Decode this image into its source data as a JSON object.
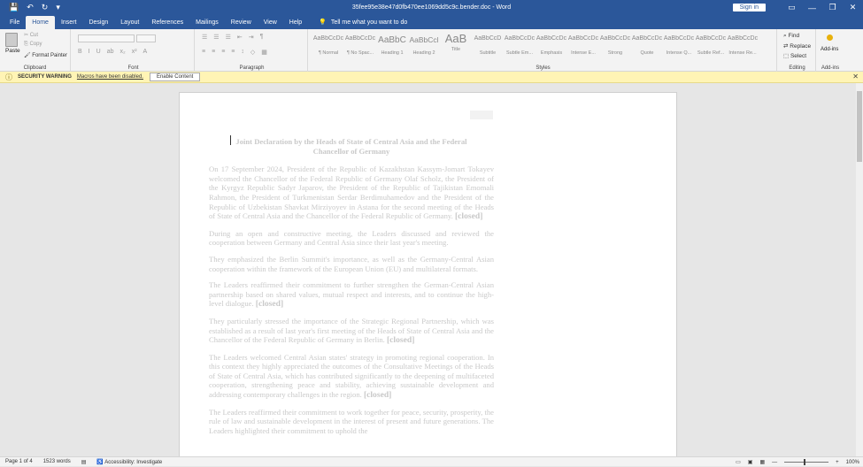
{
  "titlebar": {
    "quick_access": [
      "💾",
      "↶",
      "↻",
      "▾"
    ],
    "title": "35fee95e38e47d0fb470ee1069dd5c9c.bender.doc - Word",
    "sign_in": "Sign in",
    "window_buttons": [
      "▭",
      "—",
      "❐",
      "✕"
    ]
  },
  "tabs": [
    {
      "label": "File",
      "active": false
    },
    {
      "label": "Home",
      "active": true
    },
    {
      "label": "Insert",
      "active": false
    },
    {
      "label": "Design",
      "active": false
    },
    {
      "label": "Layout",
      "active": false
    },
    {
      "label": "References",
      "active": false
    },
    {
      "label": "Mailings",
      "active": false
    },
    {
      "label": "Review",
      "active": false
    },
    {
      "label": "View",
      "active": false
    },
    {
      "label": "Help",
      "active": false
    }
  ],
  "tell_me": {
    "icon": "lightbulb-icon",
    "glyph": "💡",
    "text": "Tell me what you want to do"
  },
  "ribbon": {
    "clipboard": {
      "label": "Clipboard",
      "paste": "Paste",
      "cut": "Cut",
      "copy": "Copy",
      "format_painter": "Format Painter"
    },
    "font": {
      "label": "Font"
    },
    "paragraph": {
      "label": "Paragraph"
    },
    "styles": {
      "label": "Styles",
      "items": [
        {
          "preview": "AaBbCcDc",
          "name": "¶ Normal"
        },
        {
          "preview": "AaBbCcDc",
          "name": "¶ No Spac..."
        },
        {
          "preview": "AaBbC",
          "name": "Heading 1"
        },
        {
          "preview": "AaBbCcl",
          "name": "Heading 2"
        },
        {
          "preview": "AaB",
          "name": "Title"
        },
        {
          "preview": "AaBbCcD",
          "name": "Subtitle"
        },
        {
          "preview": "AaBbCcDc",
          "name": "Subtle Em..."
        },
        {
          "preview": "AaBbCcDc",
          "name": "Emphasis"
        },
        {
          "preview": "AaBbCcDc",
          "name": "Intense E..."
        },
        {
          "preview": "AaBbCcDc",
          "name": "Strong"
        },
        {
          "preview": "AaBbCcDc",
          "name": "Quote"
        },
        {
          "preview": "AaBbCcDc",
          "name": "Intense Q..."
        },
        {
          "preview": "AaBbCcDc",
          "name": "Subtle Ref..."
        },
        {
          "preview": "AaBbCcDc",
          "name": "Intense Re..."
        }
      ]
    },
    "editing": {
      "label": "Editing",
      "find": "Find",
      "replace": "Replace",
      "select": "Select"
    },
    "addins": {
      "label": "Add-ins",
      "button": "Add-ins"
    }
  },
  "security_bar": {
    "title": "SECURITY WARNING",
    "message": "Macros have been disabled.",
    "button": "Enable Content"
  },
  "document": {
    "title": "Joint Declaration by the Heads of State of Central Asia and the Federal Chancellor of Germany",
    "paragraphs": [
      "On 17 September 2024, President of the Republic of Kazakhstan Kassym-Jomart Tokayev welcomed the Chancellor of the Federal Republic of Germany Olaf Scholz, the President of the Kyrgyz Republic Sadyr Japarov, the President of the Republic of Tajikistan Emomali Rahmon, the President of Turkmenistan Serdar Berdimuhamedov and the President of the Republic of Uzbekistan Shavkat Mirziyoyev in Astana for the second meeting of the Heads of State of Central Asia and the Chancellor of the Federal Republic of Germany.",
      "During an open and constructive meeting, the Leaders discussed and reviewed the cooperation between Germany and Central Asia since their last year's meeting.",
      "They emphasized the Berlin Summit's importance, as well as the Germany-Central Asian cooperation within the framework of the European Union (EU) and multilateral formats.",
      "The Leaders reaffirmed their commitment to further strengthen the German-Central Asian partnership based on shared values, mutual respect and interests, and to continue the high-level dialogue.",
      "They particularly stressed the importance of the Strategic Regional Partnership, which was established as a result of last year's first meeting of the Heads of State of Central Asia and the Chancellor of the Federal Republic of Germany in Berlin.",
      "The Leaders welcomed Central Asian states' strategy in promoting regional cooperation. In this context they highly appreciated the outcomes of the Consultative Meetings of the Heads of State of Central Asia, which has contributed significantly to the deepening of multifaceted cooperation, strengthening peace and stability, achieving sustainable development and addressing contemporary challenges in the region.",
      "The Leaders reaffirmed their commitment to work together for peace, security, prosperity, the rule of law and sustainable development in the interest of present and future generations. The Leaders highlighted their commitment to uphold the"
    ],
    "closed_tag": "[closed]"
  },
  "statusbar": {
    "page": "Page 1 of 4",
    "words": "1523 words",
    "accessibility": "Accessibility: Investigate",
    "zoom": "100%"
  }
}
